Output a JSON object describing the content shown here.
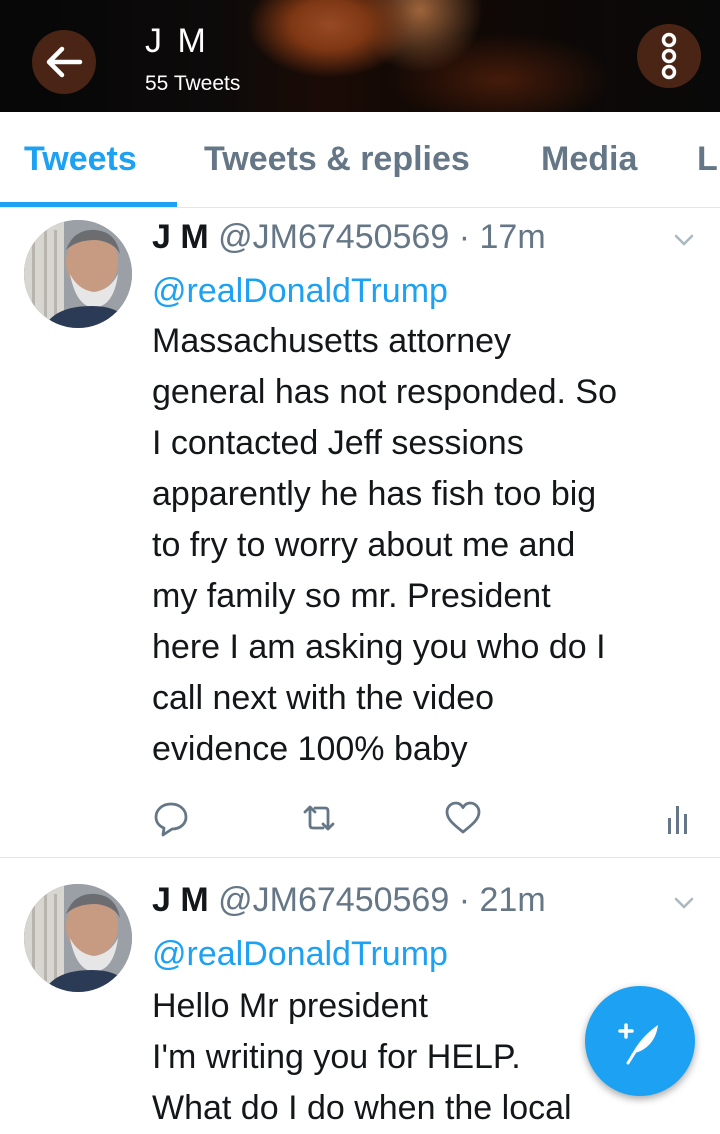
{
  "header": {
    "name": "J M",
    "tweet_count": "55 Tweets",
    "back_icon": "arrow-left-icon",
    "more_icon": "more-vertical-icon"
  },
  "tabs": [
    {
      "label": "Tweets",
      "active": true
    },
    {
      "label": "Tweets & replies",
      "active": false
    },
    {
      "label": "Media",
      "active": false
    },
    {
      "label": "L",
      "active": false
    }
  ],
  "tweets": [
    {
      "name": "J M",
      "handle": "@JM67450569",
      "separator": "·",
      "time": "17m",
      "mention": "@realDonaldTrump",
      "lines": [
        "Massachusetts attorney",
        "general has not responded. So",
        "I contacted Jeff sessions",
        "apparently he has fish too big",
        "to fry to worry about me and",
        "my family so mr. President",
        "here I am asking you who do I",
        "call next with the video",
        "evidence 100% baby"
      ],
      "actions": [
        "reply-icon",
        "retweet-icon",
        "like-icon",
        "analytics-icon"
      ]
    },
    {
      "name": "J M",
      "handle": "@JM67450569",
      "separator": "·",
      "time": "21m",
      "mention": "@realDonaldTrump",
      "lines": [
        "Hello Mr president",
        "I'm writing you for HELP.",
        "What do I do when the local"
      ]
    }
  ],
  "fab": {
    "icon": "compose-tweet-icon"
  },
  "colors": {
    "accent": "#1da1f2",
    "secondary_text": "#657786",
    "primary_text": "#14171a"
  }
}
